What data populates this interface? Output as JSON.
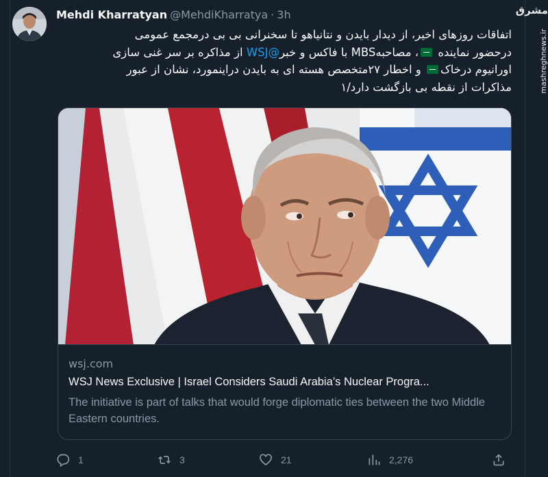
{
  "tweet": {
    "author_name": "Mehdi Kharratyan",
    "author_handle": "@MehdiKharratya",
    "separator": "·",
    "time_ago": "3h",
    "text_lines": [
      {
        "before": "اتفاقات روزهای اخیر، از دیدار بایدن و نتانیاهو تا سخنرانی بی بی درمجمع عمومی"
      },
      {
        "before": "درحضور نماینده",
        "after": "، مصاحبهMBS با فاکس و خبر",
        "mention": "@WSJ",
        "after2": " از مذاکره بر سر غنی سازی"
      },
      {
        "before": "اورانیوم درخاک",
        "after": " و اخطار ۲۷متخصص هسته ای به بایدن دراینمورد، نشان از عبور"
      },
      {
        "before": "مذاکرات از نقطه بی بازگشت دارد/۱"
      }
    ]
  },
  "card": {
    "domain": "wsj.com",
    "title": "WSJ News Exclusive | Israel Considers Saudi Arabia’s Nuclear Progra...",
    "description": "The initiative is part of talks that would forge diplomatic ties between the two Middle Eastern countries."
  },
  "actions": {
    "replies": "1",
    "retweets": "3",
    "likes": "21",
    "views": "2,276"
  },
  "watermark": {
    "logo": "مشرق",
    "url": "mashreghnews.ir"
  },
  "colors": {
    "background": "#15202b",
    "text_primary": "#f7f9f9",
    "text_secondary": "#8b98a5",
    "link": "#1d9bf0",
    "border": "#38444d"
  },
  "icons": [
    "reply-icon",
    "retweet-icon",
    "like-icon",
    "views-icon",
    "share-icon",
    "saudi-flag-icon"
  ]
}
